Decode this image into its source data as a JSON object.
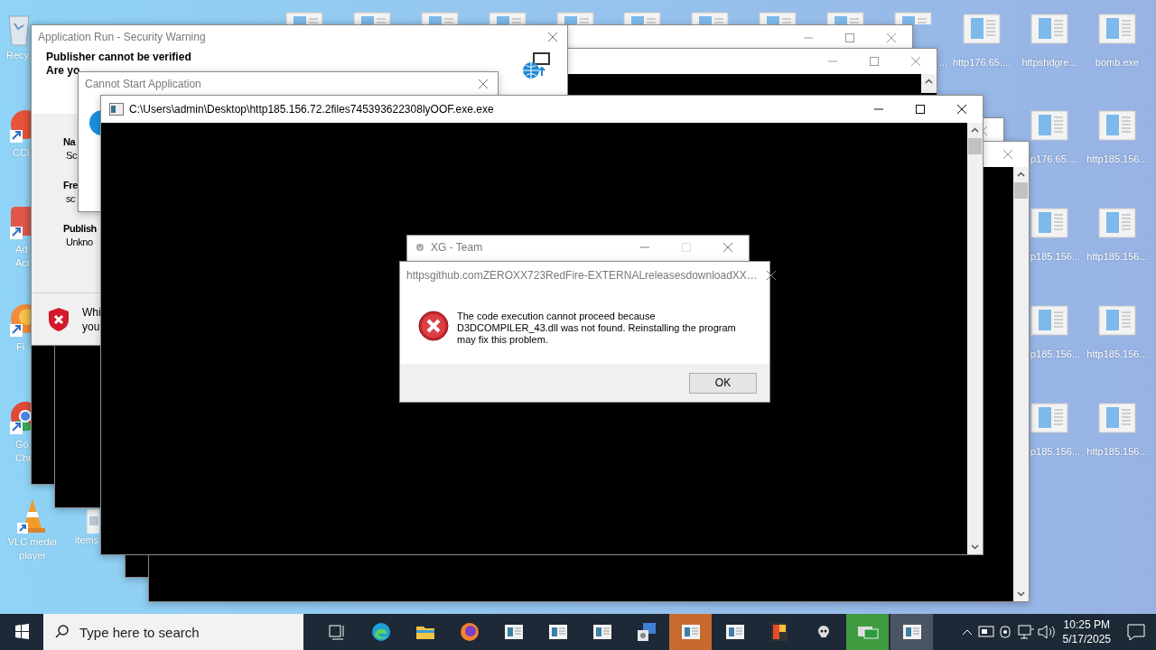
{
  "desktop": {
    "left_icons": [
      {
        "kind": "recycle",
        "lines": [
          "Recy"
        ]
      },
      {
        "kind": "ccleaner",
        "lines": [
          "CCl"
        ]
      },
      {
        "kind": "acrobat",
        "lines": [
          "Ad",
          "Acr"
        ]
      },
      {
        "kind": "firefox",
        "lines": [
          "Fi"
        ]
      },
      {
        "kind": "chrome",
        "lines": [
          "Go",
          "Chr"
        ]
      },
      {
        "kind": "vlc",
        "lines": [
          "VLC media",
          "player"
        ]
      },
      {
        "kind": "image",
        "lines": [
          "items"
        ]
      }
    ],
    "right_icons": [
      {
        "label": "..."
      },
      {
        "label": "http176.65...."
      },
      {
        "label": "httpshdgre..."
      },
      {
        "label": "bomb.exe"
      },
      {
        "label": "p176.65...."
      },
      {
        "label": "http185.156..."
      },
      {
        "label": "p185.156..."
      },
      {
        "label": "http185.156..."
      },
      {
        "label": "p185.156..."
      },
      {
        "label": "http185.156..."
      },
      {
        "label": "p185.156..."
      },
      {
        "label": "http185.156..."
      }
    ]
  },
  "security_warning": {
    "title": "Application Run - Security Warning",
    "heading": "Publisher cannot be verified",
    "question": "Are yo",
    "fields": [
      {
        "label": "Na",
        "value": "Sc"
      },
      {
        "label": "Fre",
        "value": "sc"
      },
      {
        "label": "Publish",
        "value": "Unkno"
      }
    ],
    "footer": [
      "Whi",
      "you"
    ]
  },
  "cannot_start": {
    "title": "Cannot Start Application"
  },
  "console": {
    "title": "C:\\Users\\admin\\Desktop\\http185.156.72.2files745393622308lyOOF.exe.exe"
  },
  "xg_window": {
    "title": "XG - Team"
  },
  "error_dialog": {
    "title": "httpsgithub.comZEROXX723RedFire-EXTERNALreleasesdownloadXX…",
    "message": "The code execution cannot proceed because D3DCOMPILER_43.dll was not found. Reinstalling the program may fix this problem.",
    "button": "OK"
  },
  "taskbar": {
    "search": {
      "placeholder": "Type here to search"
    },
    "apps": [
      {
        "kind": "taskview"
      },
      {
        "kind": "edge"
      },
      {
        "kind": "explorer"
      },
      {
        "kind": "firefox"
      },
      {
        "kind": "window"
      },
      {
        "kind": "window"
      },
      {
        "kind": "window"
      },
      {
        "kind": "installer"
      },
      {
        "kind": "window",
        "color": "#c86a2e"
      },
      {
        "kind": "window"
      },
      {
        "kind": "paint"
      },
      {
        "kind": "skull"
      },
      {
        "kind": "network",
        "color": "#3f9b3f"
      },
      {
        "kind": "window",
        "color": "#4a5563"
      }
    ],
    "clock": {
      "time": "10:25 PM",
      "date": "5/17/2025"
    }
  }
}
